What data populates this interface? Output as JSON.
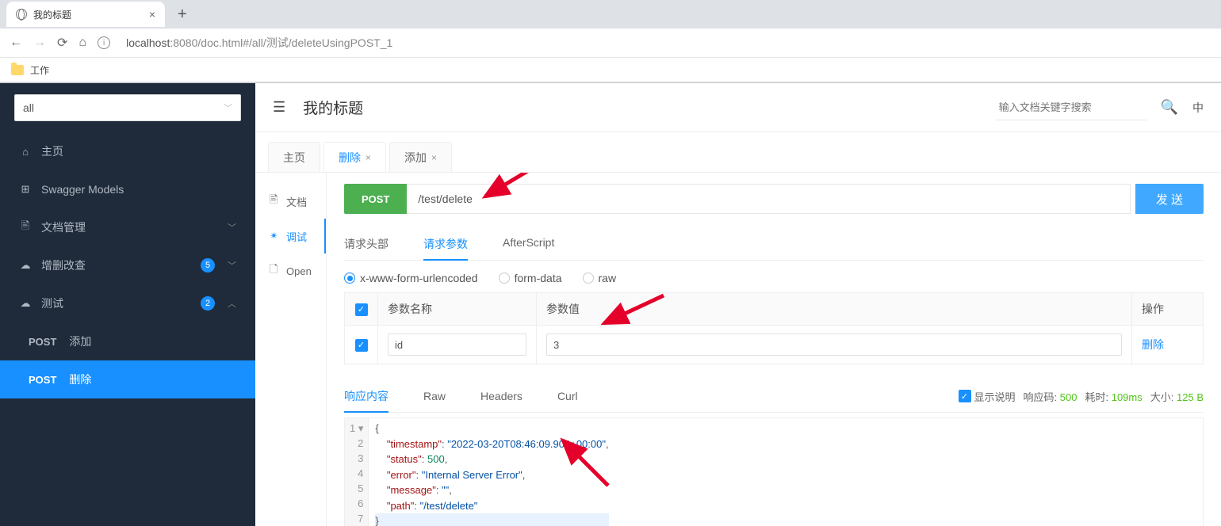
{
  "browser": {
    "tab_title": "我的标题",
    "url_domain": "localhost",
    "url_port": ":8080",
    "url_path": "/doc.html#/all/测试/deleteUsingPOST_1",
    "bookmark": "工作"
  },
  "sidebar": {
    "select_value": "all",
    "items": [
      {
        "icon": "⌂",
        "label": "主页"
      },
      {
        "icon": "⊞",
        "label": "Swagger Models"
      },
      {
        "icon": "🖹",
        "label": "文档管理",
        "arrow": "﹀"
      },
      {
        "icon": "☁",
        "label": "增删改查",
        "badge": "5",
        "arrow": "﹀"
      },
      {
        "icon": "☁",
        "label": "测试",
        "badge": "2",
        "arrow": "︿",
        "expanded": true
      }
    ],
    "subitems": [
      {
        "method": "POST",
        "label": "添加"
      },
      {
        "method": "POST",
        "label": "删除",
        "active": true
      }
    ]
  },
  "header": {
    "title": "我的标题",
    "search_placeholder": "输入文档关键字搜索",
    "lang": "中"
  },
  "tabs": [
    {
      "label": "主页",
      "closable": false
    },
    {
      "label": "删除",
      "closable": true,
      "active": true
    },
    {
      "label": "添加",
      "closable": true
    }
  ],
  "inner_nav": [
    {
      "icon": "🖹",
      "label": "文档"
    },
    {
      "icon": "✴",
      "label": "调试",
      "active": true
    },
    {
      "icon": "🗋",
      "label": "Open"
    }
  ],
  "request": {
    "method": "POST",
    "url": "/test/delete",
    "send_label": "发 送"
  },
  "req_subtabs": [
    {
      "label": "请求头部"
    },
    {
      "label": "请求参数",
      "active": true
    },
    {
      "label": "AfterScript"
    }
  ],
  "body_types": [
    {
      "label": "x-www-form-urlencoded",
      "checked": true
    },
    {
      "label": "form-data"
    },
    {
      "label": "raw"
    }
  ],
  "param_headers": {
    "name": "参数名称",
    "value": "参数值",
    "op": "操作"
  },
  "params": [
    {
      "name": "id",
      "value": "3",
      "del": "删除"
    }
  ],
  "resp_tabs": [
    {
      "label": "响应内容",
      "active": true
    },
    {
      "label": "Raw"
    },
    {
      "label": "Headers"
    },
    {
      "label": "Curl"
    }
  ],
  "resp_meta": {
    "show_desc_label": "显示说明",
    "code_label": "响应码:",
    "code": "500",
    "time_label": "耗时:",
    "time": "109ms",
    "size_label": "大小:",
    "size": "125 B"
  },
  "response_json": {
    "lines": [
      "{",
      "    \"timestamp\": \"2022-03-20T08:46:09.902+00:00\",",
      "    \"status\": 500,",
      "    \"error\": \"Internal Server Error\",",
      "    \"message\": \"\",",
      "    \"path\": \"/test/delete\"",
      "}"
    ]
  }
}
